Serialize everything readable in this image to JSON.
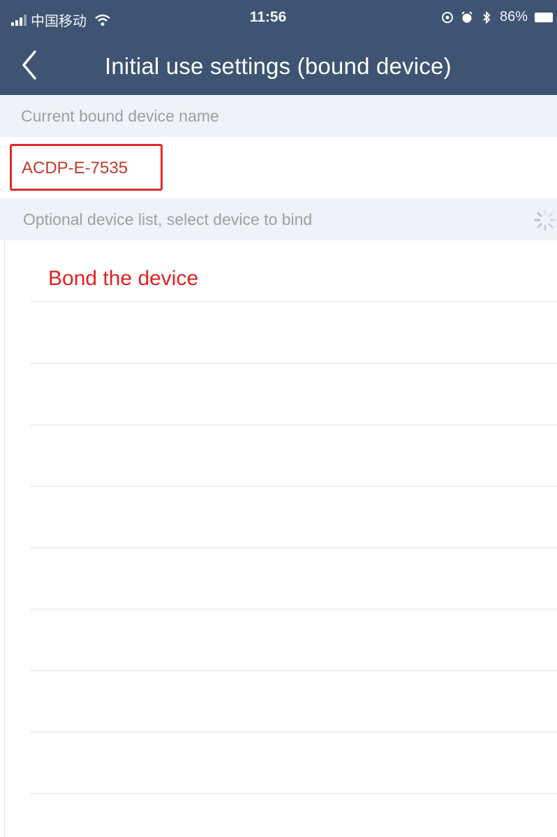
{
  "status_bar": {
    "carrier": "中国移动",
    "time": "11:56",
    "battery": "86%"
  },
  "nav": {
    "title": "Initial use settings (bound device)",
    "back_icon": "chevron-left-icon"
  },
  "bound_section": {
    "header": "Current bound device name",
    "device_name": "ACDP-E-7535"
  },
  "optional_section": {
    "header": "Optional device list, select device to bind",
    "loading_icon": "spinner-icon"
  },
  "annotation": "Bond the device",
  "colors": {
    "nav_bg": "#3e5472",
    "section_bg": "#f0f2f7",
    "highlight_red": "#e12a2a"
  }
}
